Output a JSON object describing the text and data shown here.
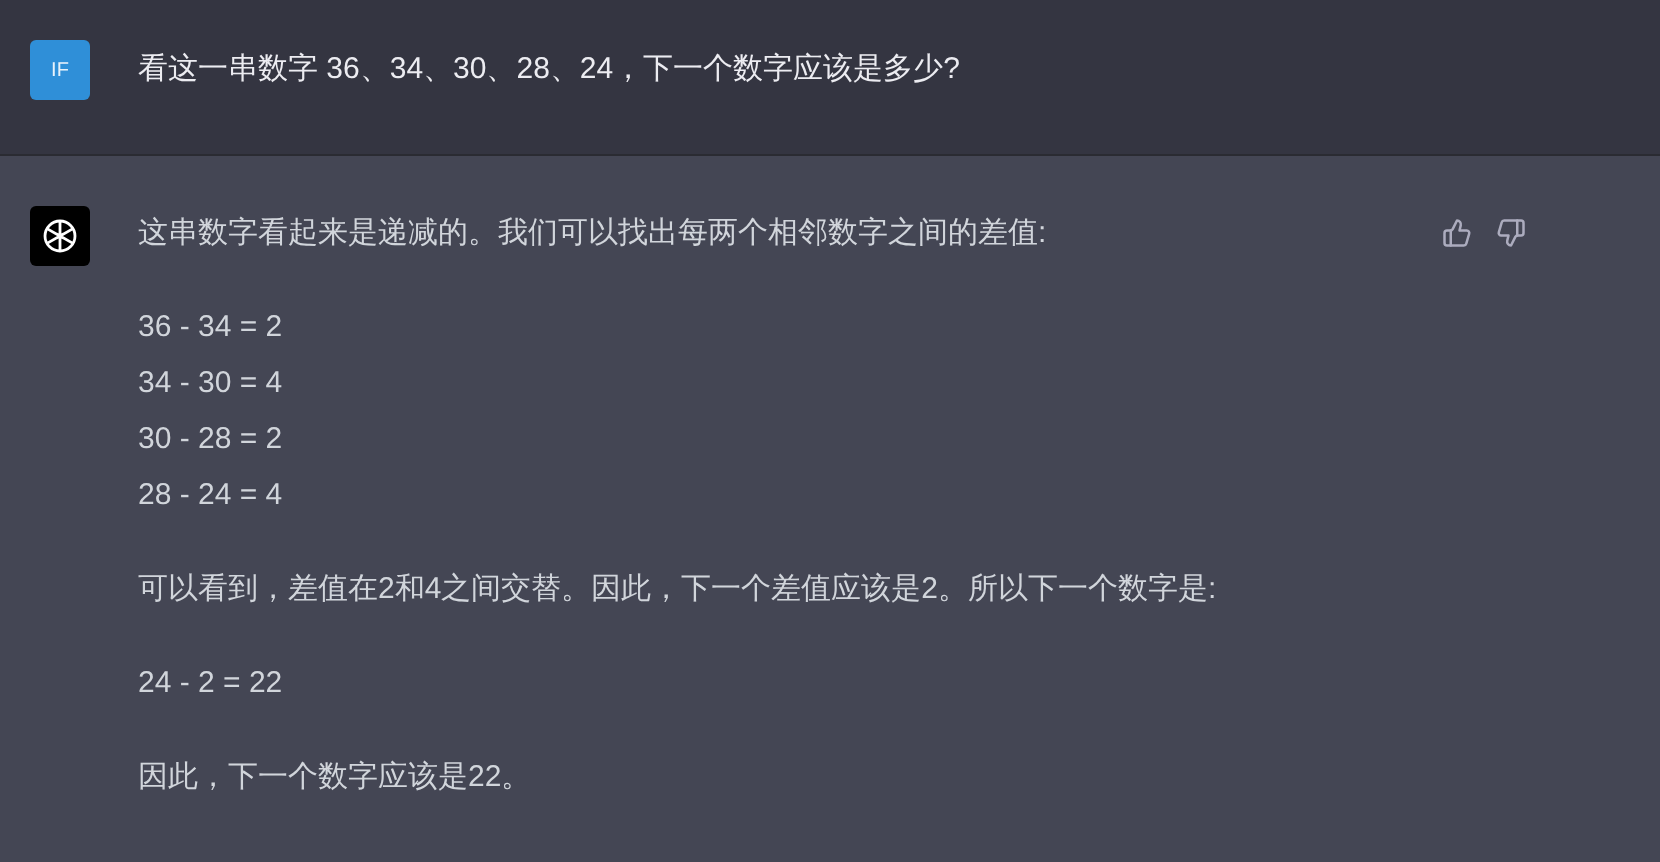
{
  "user_message": {
    "avatar": "IF",
    "text": "看这一串数字 36、34、30、28、24，下一个数字应该是多少?"
  },
  "assistant_message": {
    "paragraphs": [
      {
        "lines": [
          "这串数字看起来是递减的。我们可以找出每两个相邻数字之间的差值:"
        ]
      },
      {
        "lines": [
          "36 - 34 = 2",
          "34 - 30 = 4",
          "30 - 28 = 2",
          "28 - 24 = 4"
        ]
      },
      {
        "lines": [
          "可以看到，差值在2和4之间交替。因此，下一个差值应该是2。所以下一个数字是:"
        ]
      },
      {
        "lines": [
          "24 - 2 = 22"
        ]
      },
      {
        "lines": [
          "因此，下一个数字应该是22。"
        ]
      }
    ]
  }
}
